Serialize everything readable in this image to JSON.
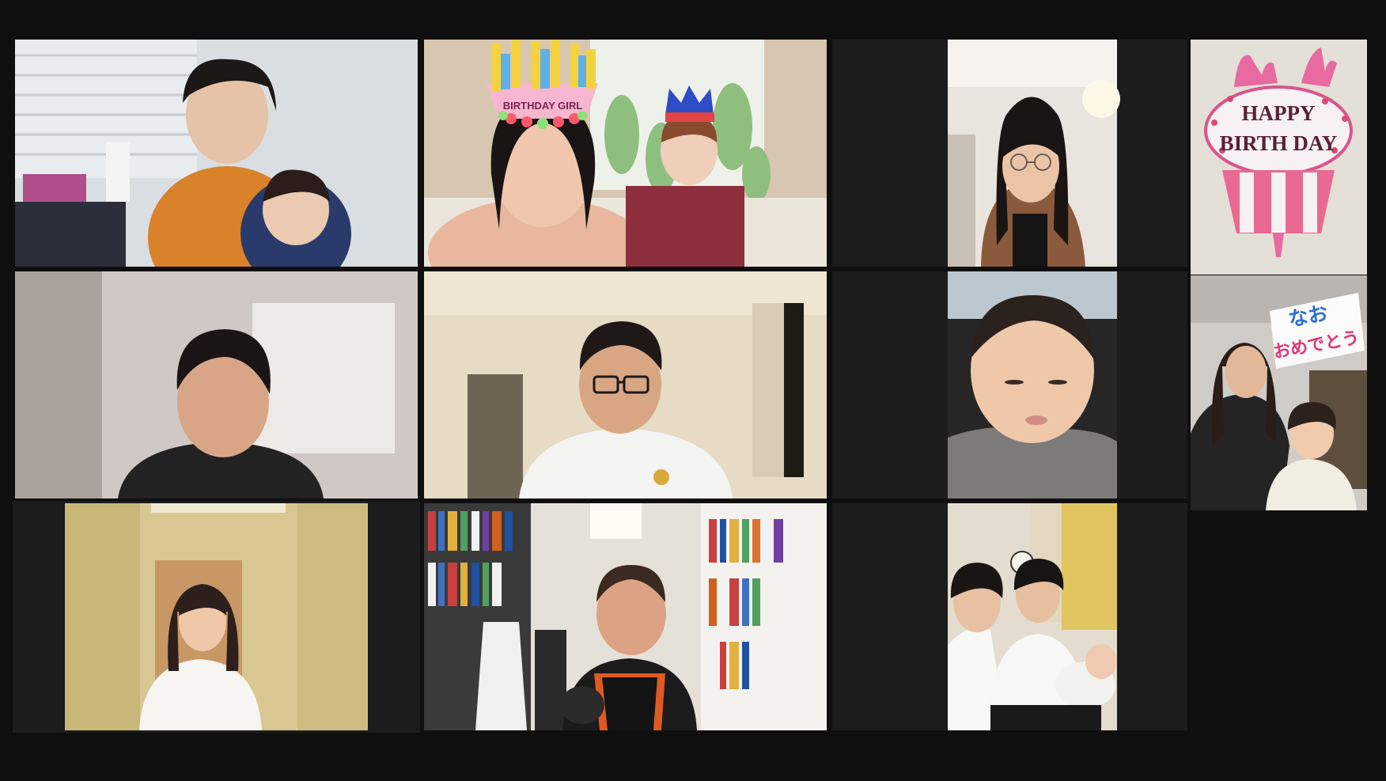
{
  "meeting": {
    "view": "gallery",
    "grid": {
      "columns": 4,
      "rows": 3,
      "extra_column_tiles": 2
    },
    "active_speaker_color": "#d8e07a",
    "background_color": "#0f0f0f",
    "tile_background_color": "#1c1c1c"
  },
  "tiles": [
    {
      "id": "woman-with-baby",
      "active": false,
      "scene": "woman in orange top holding baby, window blinds"
    },
    {
      "id": "birthday-couple",
      "active": false,
      "scene": "woman wearing birthday tiara and man in crown"
    },
    {
      "id": "woman-glasses",
      "active": false,
      "scene": "smiling woman with glasses"
    },
    {
      "id": "man-blurred-background",
      "active": false,
      "scene": "man in dark shirt, blurred room"
    },
    {
      "id": "man-glasses-white-shirt",
      "active": false,
      "scene": "man with glasses, white t-shirt"
    },
    {
      "id": "toddler-closeup",
      "active": false,
      "scene": "toddler in gray scarf"
    },
    {
      "id": "woman-hallway",
      "active": true,
      "scene": "woman in white top standing in hallway"
    },
    {
      "id": "man-bookshelves",
      "active": false,
      "scene": "man in tank top in front of bookshelves"
    },
    {
      "id": "family-with-newborn",
      "active": false,
      "scene": "couple holding newborn baby"
    },
    {
      "id": "balloon-photo",
      "active": false,
      "scene": "birthday cake balloon"
    },
    {
      "id": "mother-child-sign",
      "active": false,
      "scene": "woman and child with handwritten sign"
    }
  ],
  "balloon": {
    "line1": "HAPPY",
    "line2": "BIRTH DAY"
  },
  "tiara": {
    "text": "BIRTHDAY GIRL"
  },
  "sign": {
    "line1": "なお",
    "line2": "おめでとう"
  }
}
